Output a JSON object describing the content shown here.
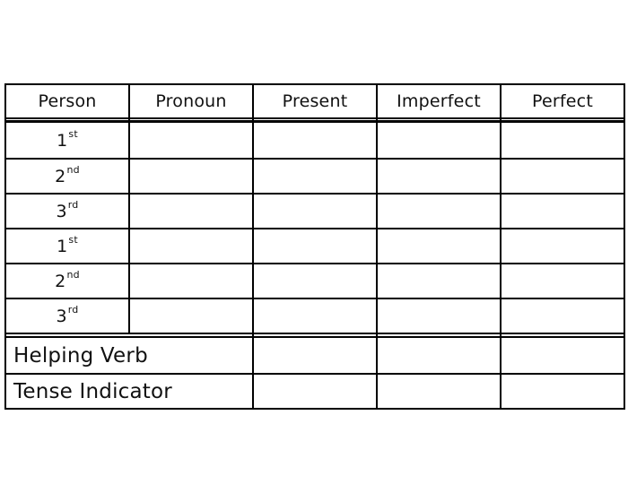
{
  "table": {
    "headers": [
      "Person",
      "Pronoun",
      "Present",
      "Imperfect",
      "Perfect"
    ],
    "rows": [
      {
        "person": "1",
        "suffix": "st",
        "pronoun": "",
        "present": "",
        "imperfect": "",
        "perfect": ""
      },
      {
        "person": "2",
        "suffix": "nd",
        "pronoun": "",
        "present": "",
        "imperfect": "",
        "perfect": ""
      },
      {
        "person": "3",
        "suffix": "rd",
        "pronoun": "",
        "present": "",
        "imperfect": "",
        "perfect": ""
      },
      {
        "person": "1",
        "suffix": "st",
        "pronoun": "",
        "present": "",
        "imperfect": "",
        "perfect": ""
      },
      {
        "person": "2",
        "suffix": "nd",
        "pronoun": "",
        "present": "",
        "imperfect": "",
        "perfect": ""
      },
      {
        "person": "3",
        "suffix": "rd",
        "pronoun": "",
        "present": "",
        "imperfect": "",
        "perfect": ""
      }
    ],
    "footer_rows": [
      {
        "label": "Helping Verb",
        "present": "",
        "imperfect": "",
        "perfect": ""
      },
      {
        "label": "Tense Indicator",
        "present": "",
        "imperfect": "",
        "perfect": ""
      }
    ]
  }
}
